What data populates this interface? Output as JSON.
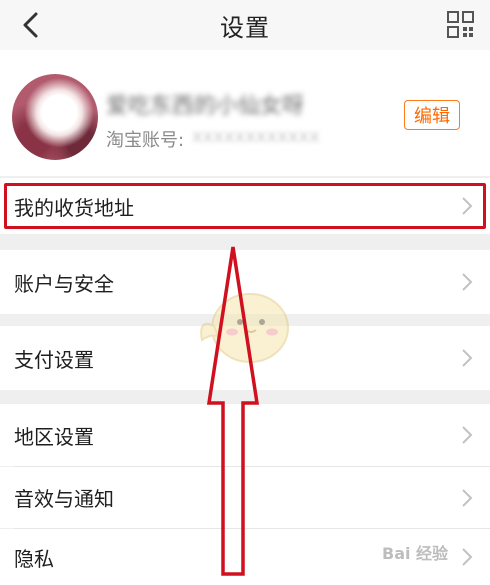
{
  "header": {
    "title": "设置",
    "back_icon": "chevron-left-icon",
    "menu_icon": "grid-icon"
  },
  "profile": {
    "nickname": "爱吃东西的小仙女呀",
    "account_label": "淘宝账号:",
    "account_value": "xxxxxxxxxxxx",
    "edit_label": "编辑"
  },
  "menu": {
    "address": "我的收货地址",
    "security": "账户与安全",
    "payment": "支付设置",
    "region": "地区设置",
    "sound": "音效与通知",
    "privacy": "隐私"
  },
  "watermark": "Bai 经验",
  "colors": {
    "accent": "#ff6a00",
    "highlight": "#d0101f",
    "background": "#efefef"
  }
}
